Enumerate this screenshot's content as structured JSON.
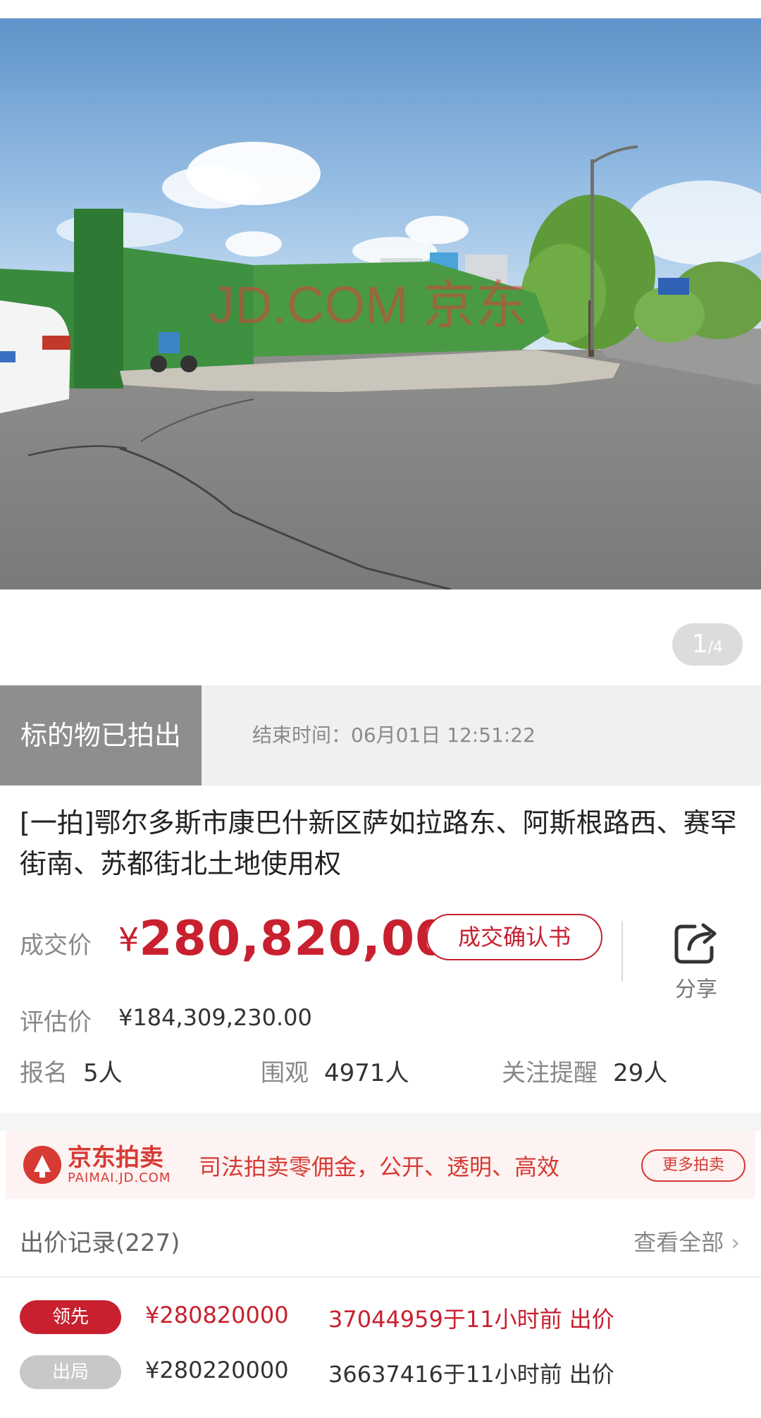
{
  "gallery": {
    "current": "1",
    "total": "/4",
    "watermark": "JD.COM 京东"
  },
  "status": {
    "sold_label": "标的物已拍出",
    "end_time": "结束时间：06月01日 12:51:22"
  },
  "item": {
    "title": "[一拍]鄂尔多斯市康巴什新区萨如拉路东、阿斯根路西、赛罕街南、苏都街北土地使用权"
  },
  "price": {
    "deal_label": "成交价",
    "currency": "¥",
    "deal_value": "280,820,000",
    "confirm_button": "成交确认书",
    "share_label": "分享",
    "eval_label": "评估价",
    "eval_value": "¥184,309,230.00"
  },
  "stats": [
    {
      "key": "报名",
      "value": "5人"
    },
    {
      "key": "围观",
      "value": "4971人"
    },
    {
      "key": "关注提醒",
      "value": "29人"
    }
  ],
  "banner": {
    "logo_cn": "京东拍卖",
    "logo_en": "PAIMAI.JD.COM",
    "slogan": "司法拍卖零佣金，公开、透明、高效",
    "more_button": "更多拍卖"
  },
  "bids": {
    "title": "出价记录(227)",
    "view_all": "查看全部",
    "rows": [
      {
        "tag": "领先",
        "price": "¥280820000",
        "info": "37044959于11小时前 出价"
      },
      {
        "tag": "出局",
        "price": "¥280220000",
        "info": "36637416于11小时前 出价"
      }
    ]
  },
  "colors": {
    "accent": "#c8202f",
    "sold_bg": "#8e8e8e",
    "banner_bg": "#fdf3f2"
  }
}
